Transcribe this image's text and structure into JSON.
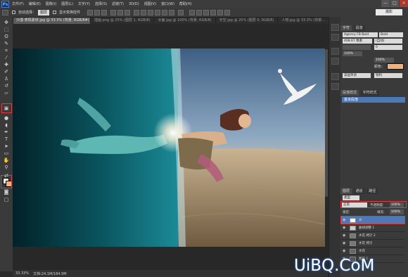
{
  "app": {
    "logo": "Ps",
    "menu": [
      "文件(F)",
      "编辑(E)",
      "图像(I)",
      "图层(L)",
      "文字(Y)",
      "选择(S)",
      "滤镜(T)",
      "3D(D)",
      "视图(V)",
      "窗口(W)",
      "帮助(H)"
    ],
    "window_buttons": [
      "—",
      "□",
      "×"
    ]
  },
  "options_bar": {
    "auto_select_label": "自动选择：",
    "auto_select_value": "图层",
    "show_transform_label": "显示变换控件",
    "workspace": "摄影"
  },
  "tabs": [
    {
      "label": "沙漠-表情素材.jpg @ 33.3% (背景, RGB/8#) *",
      "active": true
    },
    {
      "label": "插画.png @ 25% (图层 1, RGB/8)",
      "active": false
    },
    {
      "label": "水面.jpg @ 100% (背景, RGB/8)",
      "active": false
    },
    {
      "label": "天空.jpg @ 25% (图层 0, RGB/8)",
      "active": false
    },
    {
      "label": "人物.jpg @ 33.3% (背景...",
      "active": false
    }
  ],
  "status": {
    "zoom": "33.33%",
    "doc": "文档:24.1M/184.9M"
  },
  "character_panel": {
    "tabs": [
      "字符",
      "段落"
    ],
    "font_family": "Agency FB Bold",
    "font_style": "Bold",
    "font_size": "408.67 像素",
    "leading": "(自动)",
    "tracking": "0",
    "scale_v": "100%",
    "scale_h": "100%",
    "color_label": "颜色：",
    "lang": "美国英语",
    "aa": "锐利"
  },
  "history_panel": {
    "tabs": [
      "段落样式",
      "字符样式"
    ],
    "item": "基本段落"
  },
  "layers_panel": {
    "tabs": [
      "图层",
      "通道",
      "路径"
    ],
    "kind": "类型",
    "blend": "正常",
    "opacity_label": "不透明度:",
    "opacity": "100%",
    "lock_label": "锁定:",
    "fill_label": "填充:",
    "fill": "100%",
    "layers": [
      {
        "name": "光",
        "selected": true
      },
      {
        "name": "曲线调整 1",
        "selected": false
      },
      {
        "name": "水花 拷贝 2",
        "selected": false
      },
      {
        "name": "水花 拷贝",
        "selected": false
      },
      {
        "name": "水花",
        "selected": false
      },
      {
        "name": "图层 1",
        "selected": false
      }
    ]
  },
  "watermark": "UiBQ.CoM",
  "colors": {
    "accent_highlight": "#e23a3a",
    "selected_layer": "#4d79b8",
    "swatch_peach": "#f2b07a"
  }
}
